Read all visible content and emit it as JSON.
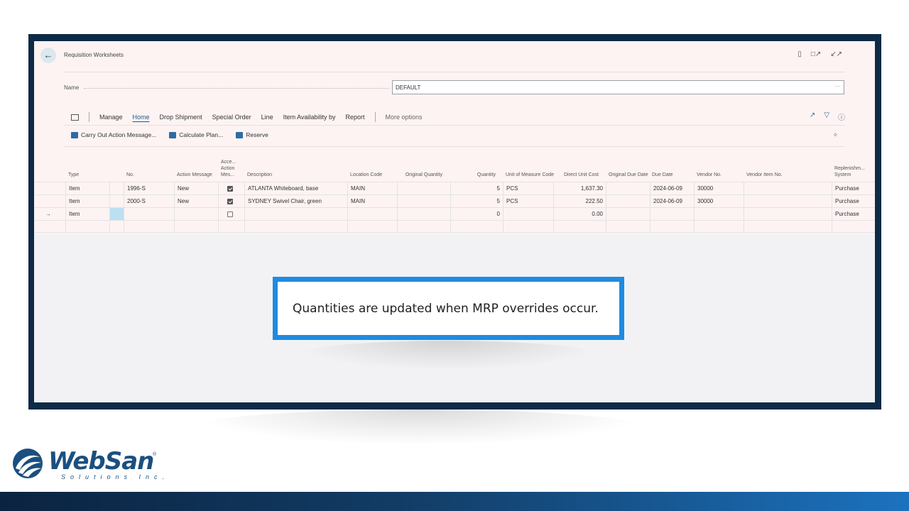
{
  "header": {
    "back_icon": "arrow-left-icon",
    "title": "Requisition Worksheets",
    "icons": [
      "bookmark-icon",
      "open-new-icon",
      "collapse-icon"
    ]
  },
  "name_field": {
    "label": "Name",
    "value": "DEFAULT",
    "more": "···"
  },
  "action_bar": {
    "menus": [
      "Manage",
      "Home",
      "Drop Shipment",
      "Special Order",
      "Line",
      "Item Availability by",
      "Report"
    ],
    "active": "Home",
    "more_options": "More options",
    "right_icons": [
      "share-icon",
      "filter-icon",
      "info-icon"
    ]
  },
  "sub_actions": {
    "carry_out": "Carry Out Action Message...",
    "calculate": "Calculate Plan...",
    "reserve": "Reserve"
  },
  "table": {
    "headers": {
      "type": "Type",
      "no": "No.",
      "action_message": "Action Message",
      "accept": "Acce... Action Mes...",
      "description": "Description",
      "location": "Location Code",
      "orig_qty": "Original Quantity",
      "quantity": "Quantity",
      "uom": "Unit of Measure Code",
      "cost": "Direct Unit Cost",
      "orig_due": "Original Due Date",
      "due": "Due Date",
      "vendor": "Vendor No.",
      "vendor_item": "Vendor Item No.",
      "replenish": "Replenishm... System"
    },
    "rows": [
      {
        "type": "Item",
        "no": "1996-S",
        "action": "New",
        "accept": true,
        "description": "ATLANTA Whiteboard, base",
        "location": "MAIN",
        "orig_qty": "",
        "quantity": "5",
        "uom": "PCS",
        "cost": "1,637.30",
        "orig_due": "",
        "due": "2024-06-09",
        "vendor": "30000",
        "vendor_item": "",
        "replenish": "Purchase"
      },
      {
        "type": "Item",
        "no": "2000-S",
        "action": "New",
        "accept": true,
        "description": "SYDNEY Swivel Chair, green",
        "location": "MAIN",
        "orig_qty": "",
        "quantity": "5",
        "uom": "PCS",
        "cost": "222.50",
        "orig_due": "",
        "due": "2024-06-09",
        "vendor": "30000",
        "vendor_item": "",
        "replenish": "Purchase"
      },
      {
        "type": "Item",
        "no": "",
        "action": "",
        "accept": false,
        "description": "",
        "location": "",
        "orig_qty": "",
        "quantity": "0",
        "uom": "",
        "cost": "0.00",
        "orig_due": "",
        "due": "",
        "vendor": "",
        "vendor_item": "",
        "replenish": "Purchase",
        "current": true
      }
    ],
    "current_row_icon": "arrow-right-icon"
  },
  "callout": {
    "text": "Quantities are updated when MRP overrides occur."
  },
  "logo": {
    "wordmark": "WebSan",
    "registered": "®",
    "tagline": "Solutions Inc."
  },
  "colors": {
    "frame": "#0d2a47",
    "callout_border": "#1f8be0",
    "accent": "#1a5a8f",
    "brand": "#1b4f80"
  }
}
